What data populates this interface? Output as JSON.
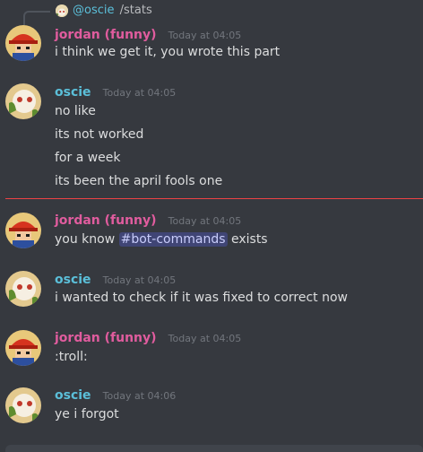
{
  "reply": {
    "author": "@oscie",
    "content": "/stats"
  },
  "messages": [
    {
      "author": "jordan (funny)",
      "timestamp": "Today at 04:05",
      "lines": [
        "i think we get it, you wrote this part"
      ]
    },
    {
      "author": "oscie",
      "timestamp": "Today at 04:05",
      "lines": [
        "no like",
        "its not worked",
        "for a week",
        "its been the april fools one"
      ]
    },
    {
      "author": "jordan (funny)",
      "timestamp": "Today at 04:05",
      "line_before": "you know ",
      "mention": "#bot-commands",
      "line_after": " exists"
    },
    {
      "author": "oscie",
      "timestamp": "Today at 04:05",
      "lines": [
        "i wanted to check if it was fixed to correct now"
      ]
    },
    {
      "author": "jordan (funny)",
      "timestamp": "Today at 04:05",
      "lines": [
        ":troll:"
      ]
    },
    {
      "author": "oscie",
      "timestamp": "Today at 04:06",
      "lines": [
        "ye i forgot"
      ]
    }
  ],
  "colors": {
    "background": "#36393f",
    "jordan_name": "#e05c9e",
    "oscie_name": "#5bbfd9",
    "new_messages_divider": "#ed4245",
    "mention_bg": "rgba(88,101,242,0.3)"
  },
  "icons": {
    "jordan_avatar": "cartoon-character-red-hat-avatar",
    "oscie_avatar": "cartoon-character-cream-avatar"
  }
}
